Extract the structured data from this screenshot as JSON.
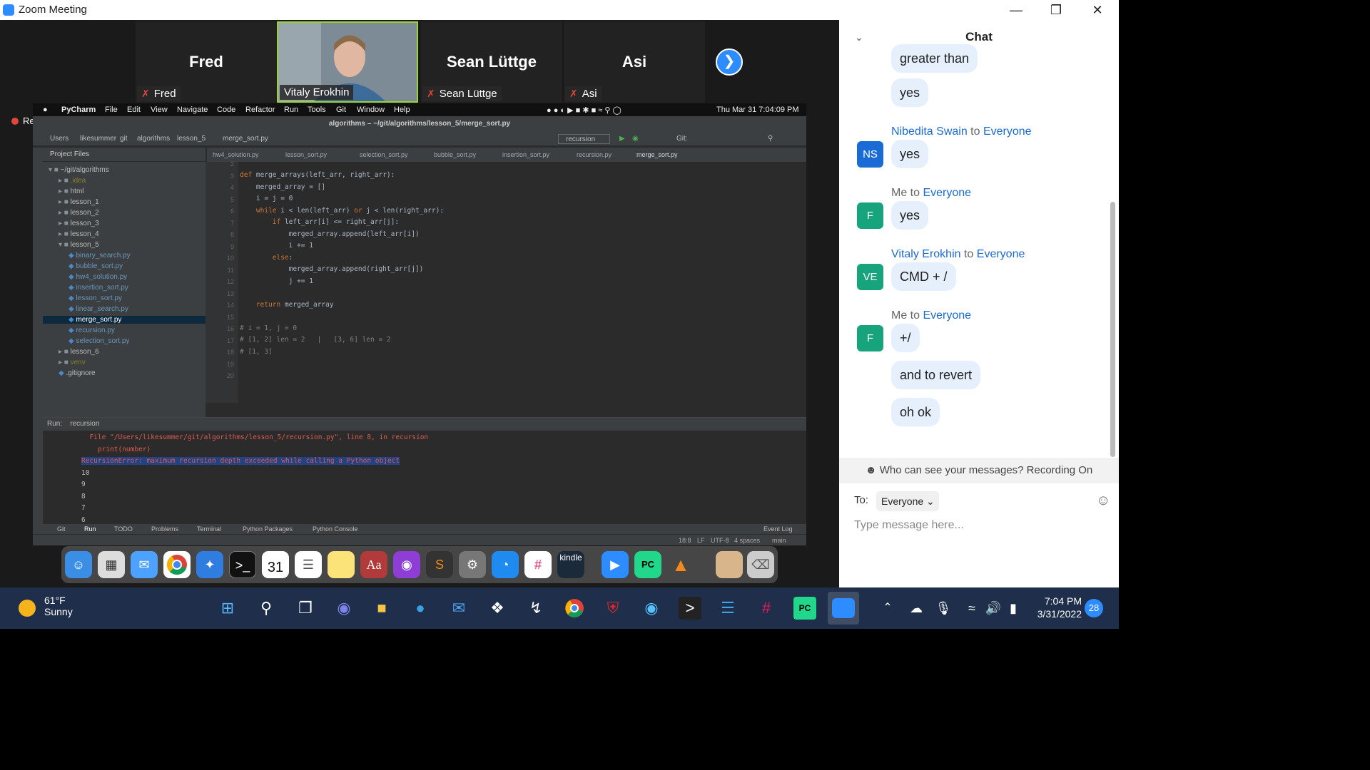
{
  "window": {
    "title": "Zoom Meeting"
  },
  "participants": [
    {
      "display": "Fred",
      "label": "Fred",
      "muted": true
    },
    {
      "display": "",
      "label": "Vitaly Erokhin",
      "muted": false
    },
    {
      "display": "Sean Lüttge",
      "label": "Sean Lüttge",
      "muted": true
    },
    {
      "display": "Asi",
      "label": "Asi",
      "muted": true
    }
  ],
  "recording_label": "Recording",
  "macbar": {
    "apple": "",
    "app": "PyCharm",
    "menus": [
      "File",
      "Edit",
      "View",
      "Navigate",
      "Code",
      "Refactor",
      "Run",
      "Tools",
      "Git",
      "Window",
      "Help"
    ],
    "clock": "Thu Mar 31  7:04:09 PM"
  },
  "pycharm": {
    "title": "algorithms – ~/git/algorithms/lesson_5/merge_sort.py",
    "breadcrumb": [
      "Users",
      "likesummer",
      "git",
      "algorithms",
      "lesson_5",
      "merge_sort.py"
    ],
    "run_config": "recursion",
    "git_label": "Git:",
    "project_header": "Project Files",
    "tabs": [
      "hw4_solution.py",
      "lesson_sort.py",
      "selection_sort.py",
      "bubble_sort.py",
      "insertion_sort.py",
      "recursion.py",
      "merge_sort.py"
    ],
    "tree": [
      {
        "t": "~/git/algorithms",
        "lvl": 0,
        "folder": true,
        "open": true
      },
      {
        "t": ".idea",
        "lvl": 1,
        "folder": true
      },
      {
        "t": "html",
        "lvl": 1,
        "folder": true
      },
      {
        "t": "lesson_1",
        "lvl": 1,
        "folder": true
      },
      {
        "t": "lesson_2",
        "lvl": 1,
        "folder": true
      },
      {
        "t": "lesson_3",
        "lvl": 1,
        "folder": true
      },
      {
        "t": "lesson_4",
        "lvl": 1,
        "folder": true
      },
      {
        "t": "lesson_5",
        "lvl": 1,
        "folder": true,
        "open": true
      },
      {
        "t": "binary_search.py",
        "lvl": 2
      },
      {
        "t": "bubble_sort.py",
        "lvl": 2
      },
      {
        "t": "hw4_solution.py",
        "lvl": 2
      },
      {
        "t": "insertion_sort.py",
        "lvl": 2
      },
      {
        "t": "lesson_sort.py",
        "lvl": 2
      },
      {
        "t": "linear_search.py",
        "lvl": 2
      },
      {
        "t": "merge_sort.py",
        "lvl": 2,
        "selected": true
      },
      {
        "t": "recursion.py",
        "lvl": 2
      },
      {
        "t": "selection_sort.py",
        "lvl": 2
      },
      {
        "t": "lesson_6",
        "lvl": 1,
        "folder": true
      },
      {
        "t": "venv",
        "lvl": 1,
        "folder": true
      },
      {
        "t": ".gitignore",
        "lvl": 1
      }
    ],
    "line_numbers": [
      "2",
      "3",
      "4",
      "5",
      "6",
      "7",
      "8",
      "9",
      "10",
      "11",
      "12",
      "13",
      "14",
      "15",
      "16",
      "17",
      "18",
      "19",
      "20"
    ],
    "code": [
      "def merge_arrays(left_arr, right_arr):",
      "    merged_array = []",
      "    i = j = 0",
      "    while i < len(left_arr) or j < len(right_arr):",
      "        if left_arr[i] <= right_arr[j]:",
      "            merged_array.append(left_arr[i])",
      "            i += 1",
      "        else:",
      "            merged_array.append(right_arr[j])",
      "            j += 1",
      "",
      "    return merged_array",
      "",
      "# i = 1, j = 0",
      "# [1, 2] len = 2   |   [3, 6] len = 2",
      "# [1, 3]",
      "",
      ""
    ],
    "run_label": "Run:",
    "run_tab": "recursion",
    "output": [
      {
        "t": "  File \"/Users/likesummer/git/algorithms/lesson_5/recursion.py\", line 8, in recursion",
        "c": "#e05a4f"
      },
      {
        "t": "    print(number)",
        "c": "#e05a4f"
      },
      {
        "t": "RecursionError: maximum recursion depth exceeded while calling a Python object",
        "c": "#e05a4f"
      },
      {
        "t": "10",
        "c": "#bbb"
      },
      {
        "t": "9",
        "c": "#bbb"
      },
      {
        "t": "8",
        "c": "#bbb"
      },
      {
        "t": "7",
        "c": "#bbb"
      },
      {
        "t": "6",
        "c": "#bbb"
      }
    ],
    "bottom_tabs": [
      "Git",
      "Run",
      "TODO",
      "Problems",
      "Terminal",
      "Python Packages",
      "Python Console"
    ],
    "event_log": "Event Log",
    "status": [
      "18:8",
      "LF",
      "UTF-8",
      "4 spaces",
      "main"
    ]
  },
  "chat": {
    "title": "Chat",
    "messages": [
      {
        "sender": "",
        "to": "",
        "text": "greater than",
        "avatar": ""
      },
      {
        "sender": "",
        "to": "",
        "text": "yes",
        "avatar": ""
      },
      {
        "sender": "Nibedita Swain",
        "to": "Everyone",
        "text": "yes",
        "avatar": "NS"
      },
      {
        "sender": "Me",
        "to": "Everyone",
        "text": "yes",
        "avatar": "F"
      },
      {
        "sender": "Vitaly Erokhin",
        "to": "Everyone",
        "text": "CMD + /",
        "avatar": "VE"
      },
      {
        "sender": "Me",
        "to": "Everyone",
        "text": "+/",
        "avatar": "F"
      },
      {
        "sender": "",
        "to": "",
        "text": "and to revert",
        "avatar": ""
      },
      {
        "sender": "",
        "to": "",
        "text": "oh ok",
        "avatar": ""
      }
    ],
    "to_word": "to",
    "privacy_note": "Who can see your messages? Recording On",
    "to_label": "To:",
    "recipient": "Everyone",
    "placeholder": "Type message here..."
  },
  "taskbar": {
    "temp": "61°F",
    "weather": "Sunny",
    "time": "7:04 PM",
    "date": "3/31/2022",
    "notifications": "28"
  },
  "dock": {
    "calendar_day": "31",
    "calendar_month": "MAR",
    "kindle": "kindle",
    "pycharm": "PC"
  },
  "colors": {
    "accent": "#2d8cff",
    "avatar": "#17a37c",
    "muted": "#e0463a"
  }
}
